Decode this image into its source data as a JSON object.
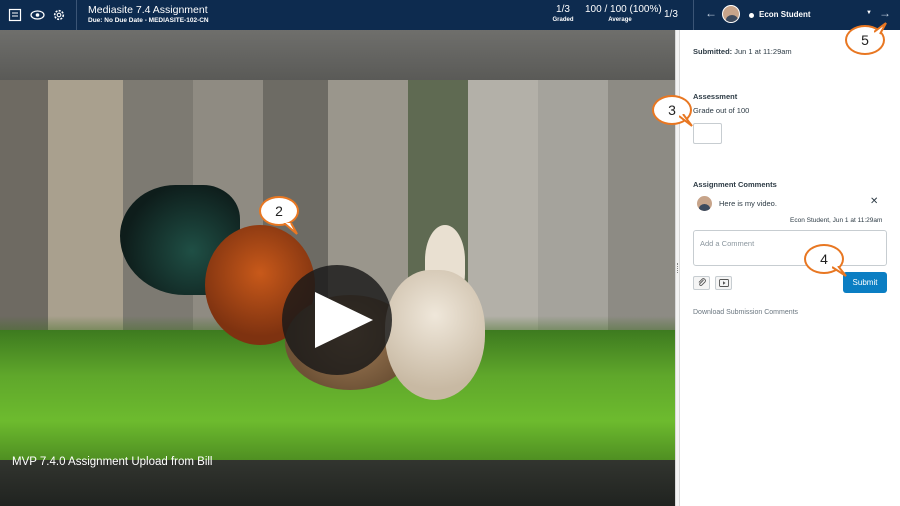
{
  "header": {
    "title": "Mediasite 7.4 Assignment",
    "subtitle": "Due: No Due Date - MEDIASITE-102-CN",
    "graded": {
      "value": "1/3",
      "label": "Graded"
    },
    "average": {
      "value": "100 / 100 (100%)",
      "label": "Average"
    },
    "student_counter": "1/3",
    "prev_arrow": "←",
    "next_arrow": "→",
    "student_name": "Econ Student",
    "dropdown_caret": "▼"
  },
  "video": {
    "caption": "MVP 7.4.0 Assignment Upload from Bill"
  },
  "panel": {
    "submitted_label": "Submitted:",
    "submitted_value": " Jun 1 at 11:29am",
    "assessment_title": "Assessment",
    "grade_label": "Grade out of 100",
    "grade_value": "",
    "comments_title": "Assignment Comments",
    "comment": {
      "text": "Here is my video.",
      "meta": "Econ Student, Jun 1 at 11:29am",
      "close": "✕"
    },
    "comment_placeholder": "Add a Comment",
    "submit_label": "Submit",
    "download_label": "Download Submission Comments"
  },
  "callouts": {
    "c2": "2",
    "c3": "3",
    "c4": "4",
    "c5": "5"
  },
  "icons": {
    "header_left": [
      "grade-book-icon",
      "eye-icon",
      "gear-icon"
    ],
    "attach": "paperclip-icon",
    "media": "media-icon",
    "play": "play-icon"
  },
  "colors": {
    "header_bg": "#0d2b4f",
    "submit_bg": "#0b7ec3",
    "callout_border": "#e87722"
  }
}
